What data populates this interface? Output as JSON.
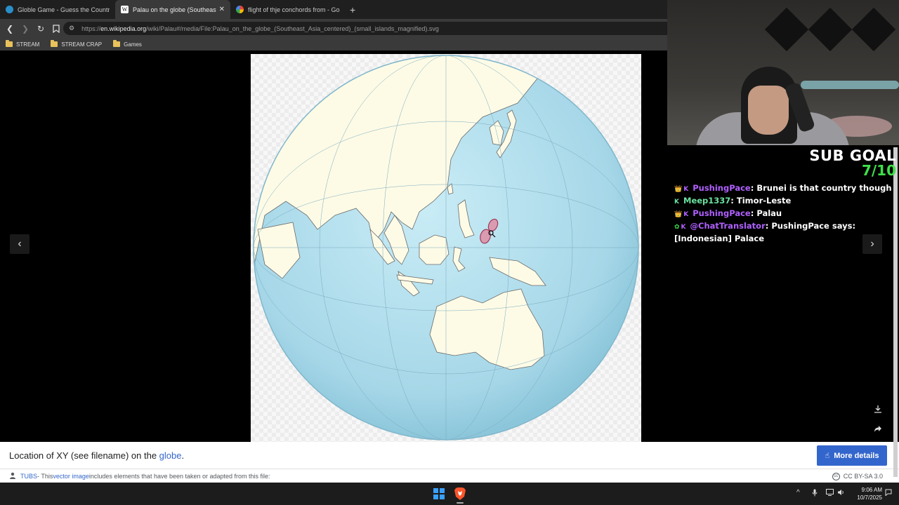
{
  "browser": {
    "tabs": [
      {
        "label": "Globle Game - Guess the Country",
        "icon": "globe-icon",
        "active": false
      },
      {
        "label": "Palau on the globe (Southeast Asia...",
        "icon": "wikipedia-icon",
        "active": true
      },
      {
        "label": "flight of thje conchords from - Google...",
        "icon": "google-icon",
        "active": false
      }
    ],
    "new_tab_label": "+",
    "url_scheme": "https://",
    "url_host": "en.wikipedia.org",
    "url_path": "/wiki/Palau#/media/File:Palau_on_the_globe_(Southeast_Asia_centered)_(small_islands_magnified).svg",
    "bookmarks": [
      "STREAM",
      "STREAM CRAP",
      "Games"
    ]
  },
  "viewer": {
    "caption_prefix": "Location of XY (see filename) on the ",
    "caption_link": "globe",
    "caption_suffix": ".",
    "more_details_label": "More details",
    "attribution_author": "TUBS",
    "attribution_mid": " - This ",
    "attribution_link": "vector image",
    "attribution_suffix": " includes elements that have been taken or adapted from this file:",
    "license": "CC BY-SA 3.0",
    "prev_arrow": "‹",
    "next_arrow": "›"
  },
  "stream": {
    "sub_goal_label": "SUB GOAL",
    "sub_goal_count": "7/10",
    "chat": [
      {
        "user": "PushingPace",
        "text": ": Brunei is that country though",
        "user_color": "purple"
      },
      {
        "user": "Meep1337",
        "text": ": Timor-Leste",
        "user_color": "green"
      },
      {
        "user": "PushingPace",
        "text": ": Palau",
        "user_color": "purple"
      },
      {
        "user": "@ChatTranslator",
        "text": ": PushingPace says: [Indonesian] Palace",
        "user_color": "purple"
      }
    ]
  },
  "taskbar": {
    "time": "9:06 AM",
    "date": "10/7/2025"
  },
  "colors": {
    "ocean": "#a8d8ea",
    "land": "#fdfbe6",
    "highlight": "#c2607a",
    "link": "#3366cc",
    "sub_count": "#3ee04a"
  }
}
